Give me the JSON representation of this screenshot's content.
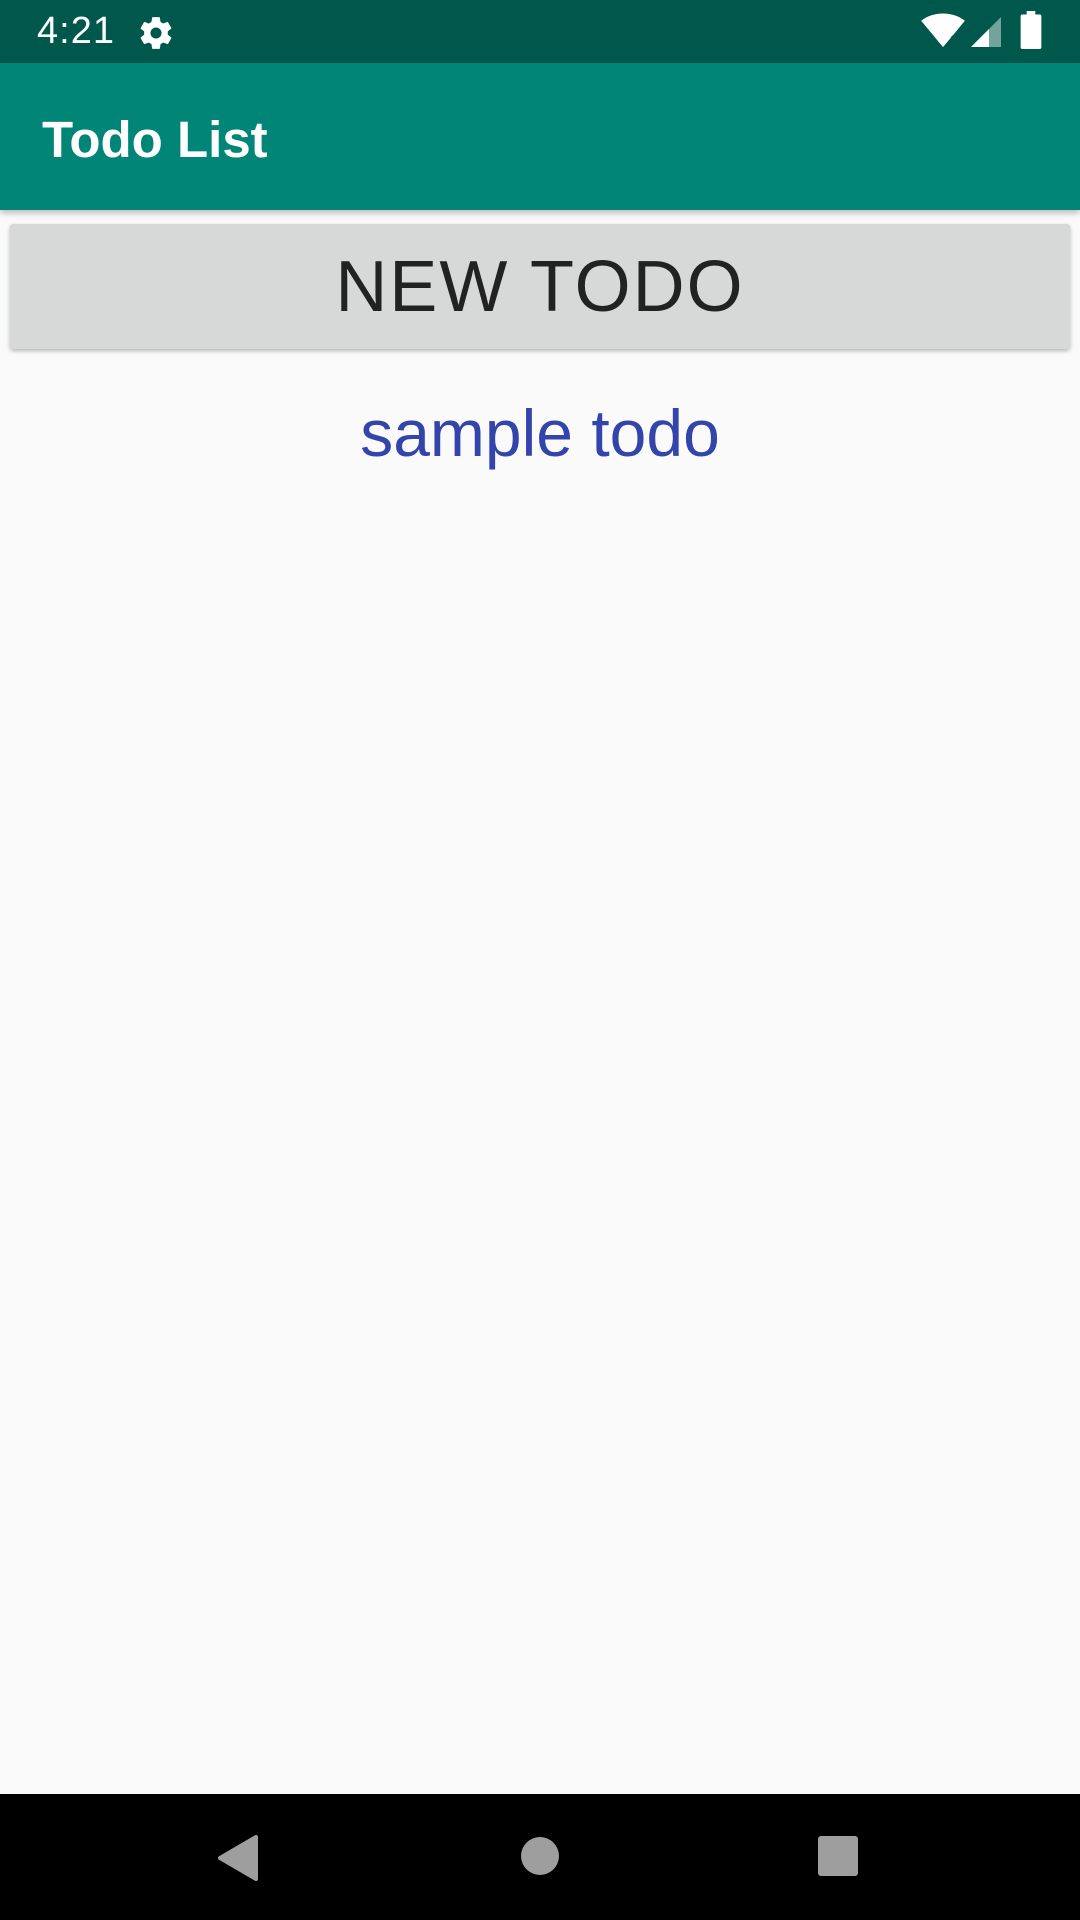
{
  "status_bar": {
    "time": "4:21",
    "icons": [
      "gear-icon",
      "wifi-icon",
      "cell-signal-icon",
      "battery-icon"
    ],
    "background": "#00584c"
  },
  "app_bar": {
    "title": "Todo List",
    "background": "#008577"
  },
  "main": {
    "new_todo_label": "NEW TODO",
    "todos": [
      "sample todo"
    ],
    "todo_color": "#3344aa"
  },
  "nav_bar": {
    "icons": [
      "back-icon",
      "home-icon",
      "recents-icon"
    ]
  }
}
